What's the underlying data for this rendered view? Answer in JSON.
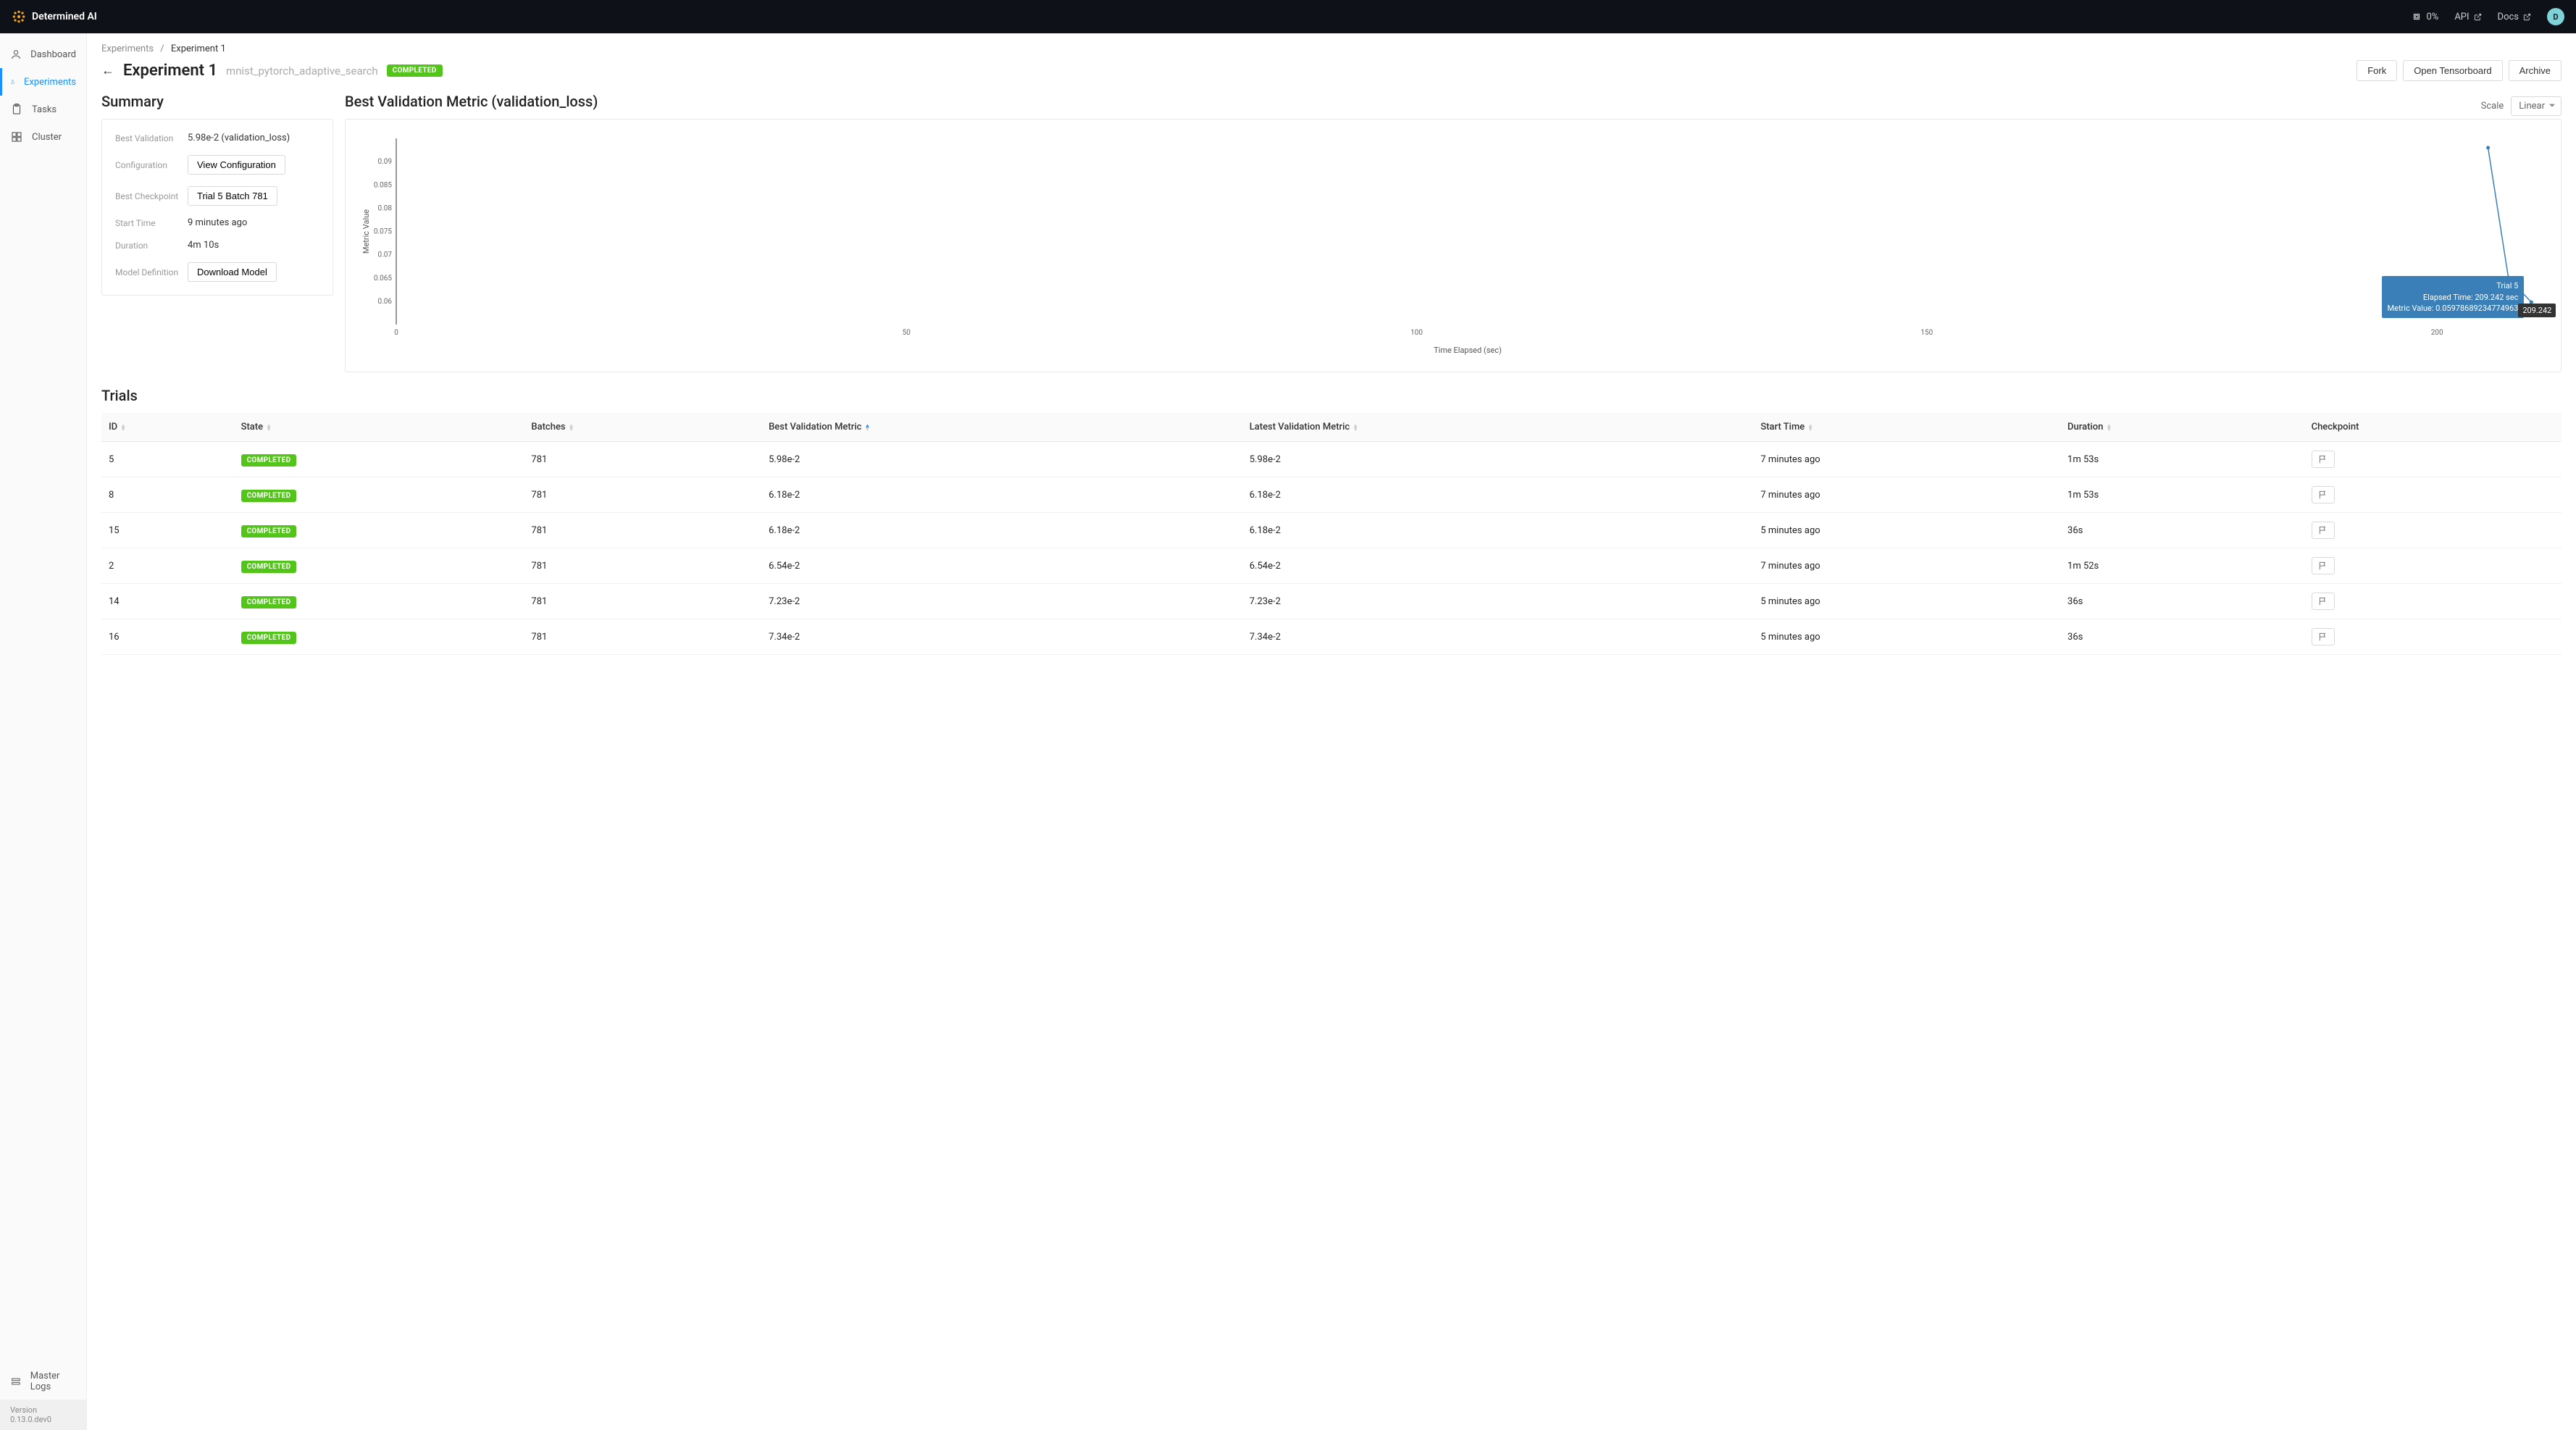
{
  "brand": "Determined AI",
  "topbar": {
    "usage": "0%",
    "api": "API",
    "docs": "Docs",
    "avatar_letter": "D"
  },
  "sidebar": {
    "items": [
      {
        "label": "Dashboard"
      },
      {
        "label": "Experiments"
      },
      {
        "label": "Tasks"
      },
      {
        "label": "Cluster"
      }
    ],
    "master_logs": "Master Logs",
    "version": "Version 0.13.0.dev0"
  },
  "breadcrumb": {
    "parent": "Experiments",
    "sep": "/",
    "current": "Experiment 1"
  },
  "header": {
    "title": "Experiment 1",
    "subtitle": "mnist_pytorch_adaptive_search",
    "status": "COMPLETED",
    "fork": "Fork",
    "tensorboard": "Open Tensorboard",
    "archive": "Archive"
  },
  "summary": {
    "title": "Summary",
    "rows": {
      "best_validation_label": "Best Validation",
      "best_validation_value": "5.98e-2 (validation_loss)",
      "configuration_label": "Configuration",
      "configuration_btn": "View Configuration",
      "best_checkpoint_label": "Best Checkpoint",
      "best_checkpoint_btn": "Trial 5 Batch 781",
      "start_time_label": "Start Time",
      "start_time_value": "9 minutes ago",
      "duration_label": "Duration",
      "duration_value": "4m 10s",
      "model_def_label": "Model Definition",
      "model_def_btn": "Download Model"
    }
  },
  "chart": {
    "title": "Best Validation Metric (validation_loss)",
    "scale_label": "Scale",
    "scale_value": "Linear",
    "ylabel": "Metric Value",
    "xlabel": "Time Elapsed (sec)",
    "tooltip_trial": "Trial 5",
    "tooltip_elapsed": "Elapsed Time: 209.242 sec",
    "tooltip_metric": "Metric Value: 0.05978689234774963",
    "tooltip_x": "209.242"
  },
  "chart_data": {
    "type": "line",
    "xlabel": "Time Elapsed (sec)",
    "ylabel": "Metric Value",
    "xlim": [
      0,
      210
    ],
    "ylim": [
      0.055,
      0.095
    ],
    "xticks": [
      0,
      50,
      100,
      150,
      200
    ],
    "yticks": [
      0.06,
      0.065,
      0.07,
      0.075,
      0.08,
      0.085,
      0.09
    ],
    "series": [
      {
        "name": "Trial 5",
        "x": [
          205,
          207,
          209.242,
          209.242
        ],
        "y": [
          0.093,
          0.065,
          0.0598,
          0.0598
        ]
      }
    ]
  },
  "trials": {
    "title": "Trials",
    "columns": {
      "id": "ID",
      "state": "State",
      "batches": "Batches",
      "best_val": "Best Validation Metric",
      "latest_val": "Latest Validation Metric",
      "start_time": "Start Time",
      "duration": "Duration",
      "checkpoint": "Checkpoint"
    },
    "rows": [
      {
        "id": "5",
        "state": "COMPLETED",
        "batches": "781",
        "best_val": "5.98e-2",
        "latest_val": "5.98e-2",
        "start_time": "7 minutes ago",
        "duration": "1m 53s"
      },
      {
        "id": "8",
        "state": "COMPLETED",
        "batches": "781",
        "best_val": "6.18e-2",
        "latest_val": "6.18e-2",
        "start_time": "7 minutes ago",
        "duration": "1m 53s"
      },
      {
        "id": "15",
        "state": "COMPLETED",
        "batches": "781",
        "best_val": "6.18e-2",
        "latest_val": "6.18e-2",
        "start_time": "5 minutes ago",
        "duration": "36s"
      },
      {
        "id": "2",
        "state": "COMPLETED",
        "batches": "781",
        "best_val": "6.54e-2",
        "latest_val": "6.54e-2",
        "start_time": "7 minutes ago",
        "duration": "1m 52s"
      },
      {
        "id": "14",
        "state": "COMPLETED",
        "batches": "781",
        "best_val": "7.23e-2",
        "latest_val": "7.23e-2",
        "start_time": "5 minutes ago",
        "duration": "36s"
      },
      {
        "id": "16",
        "state": "COMPLETED",
        "batches": "781",
        "best_val": "7.34e-2",
        "latest_val": "7.34e-2",
        "start_time": "5 minutes ago",
        "duration": "36s"
      }
    ]
  }
}
